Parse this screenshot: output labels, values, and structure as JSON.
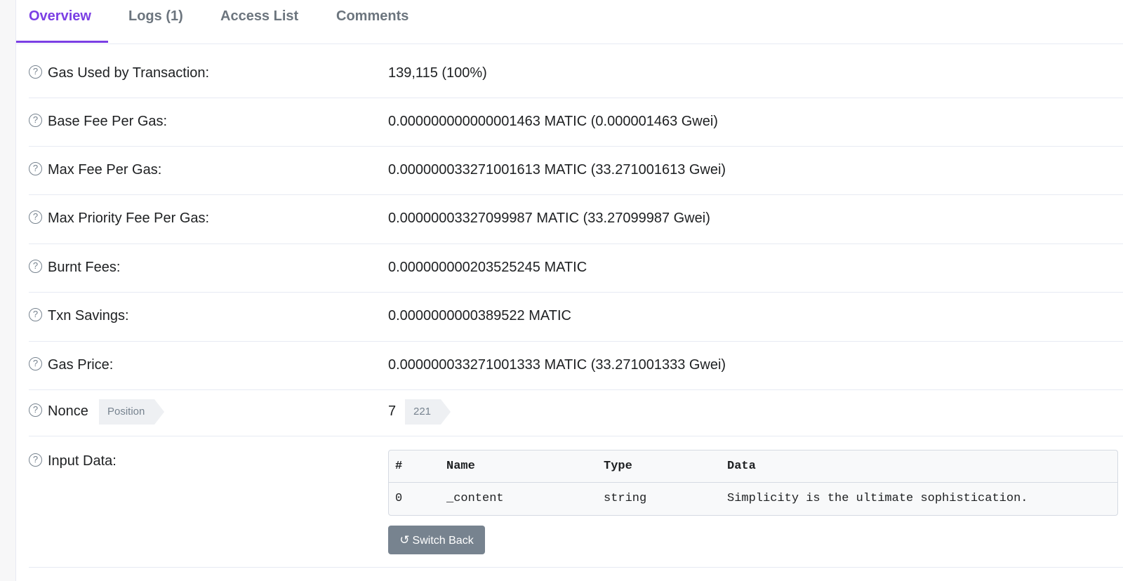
{
  "tabs": [
    {
      "label": "Overview",
      "active": true
    },
    {
      "label": "Logs (1)"
    },
    {
      "label": "Access List"
    },
    {
      "label": "Comments"
    }
  ],
  "accent_color": "#7b3fe4",
  "rows": [
    {
      "label": "Gas Used by Transaction:",
      "value": "139,115 (100%)"
    },
    {
      "label": "Base Fee Per Gas:",
      "value": "0.000000000000001463 MATIC (0.000001463 Gwei)"
    },
    {
      "label": "Max Fee Per Gas:",
      "value": "0.000000033271001613 MATIC (33.271001613 Gwei)"
    },
    {
      "label": "Max Priority Fee Per Gas:",
      "value": "0.00000003327099987 MATIC (33.27099987 Gwei)"
    },
    {
      "label": "Burnt Fees:",
      "value": "0.000000000203525245 MATIC"
    },
    {
      "label": "Txn Savings:",
      "value": "0.0000000000389522 MATIC"
    },
    {
      "label": "Gas Price:",
      "value": "0.000000033271001333 MATIC (33.271001333 Gwei)"
    }
  ],
  "nonce": {
    "label": "Nonce",
    "position_tag": "Position",
    "value": "7",
    "position_value": "221"
  },
  "input_data": {
    "label": "Input Data:",
    "headers": [
      "#",
      "Name",
      "Type",
      "Data"
    ],
    "rows": [
      [
        "0",
        "_content",
        "string",
        "Simplicity is the ultimate sophistication."
      ]
    ],
    "switch_button": "Switch Back"
  },
  "icons": {
    "help": "question-circle-icon",
    "undo": "undo-icon"
  }
}
